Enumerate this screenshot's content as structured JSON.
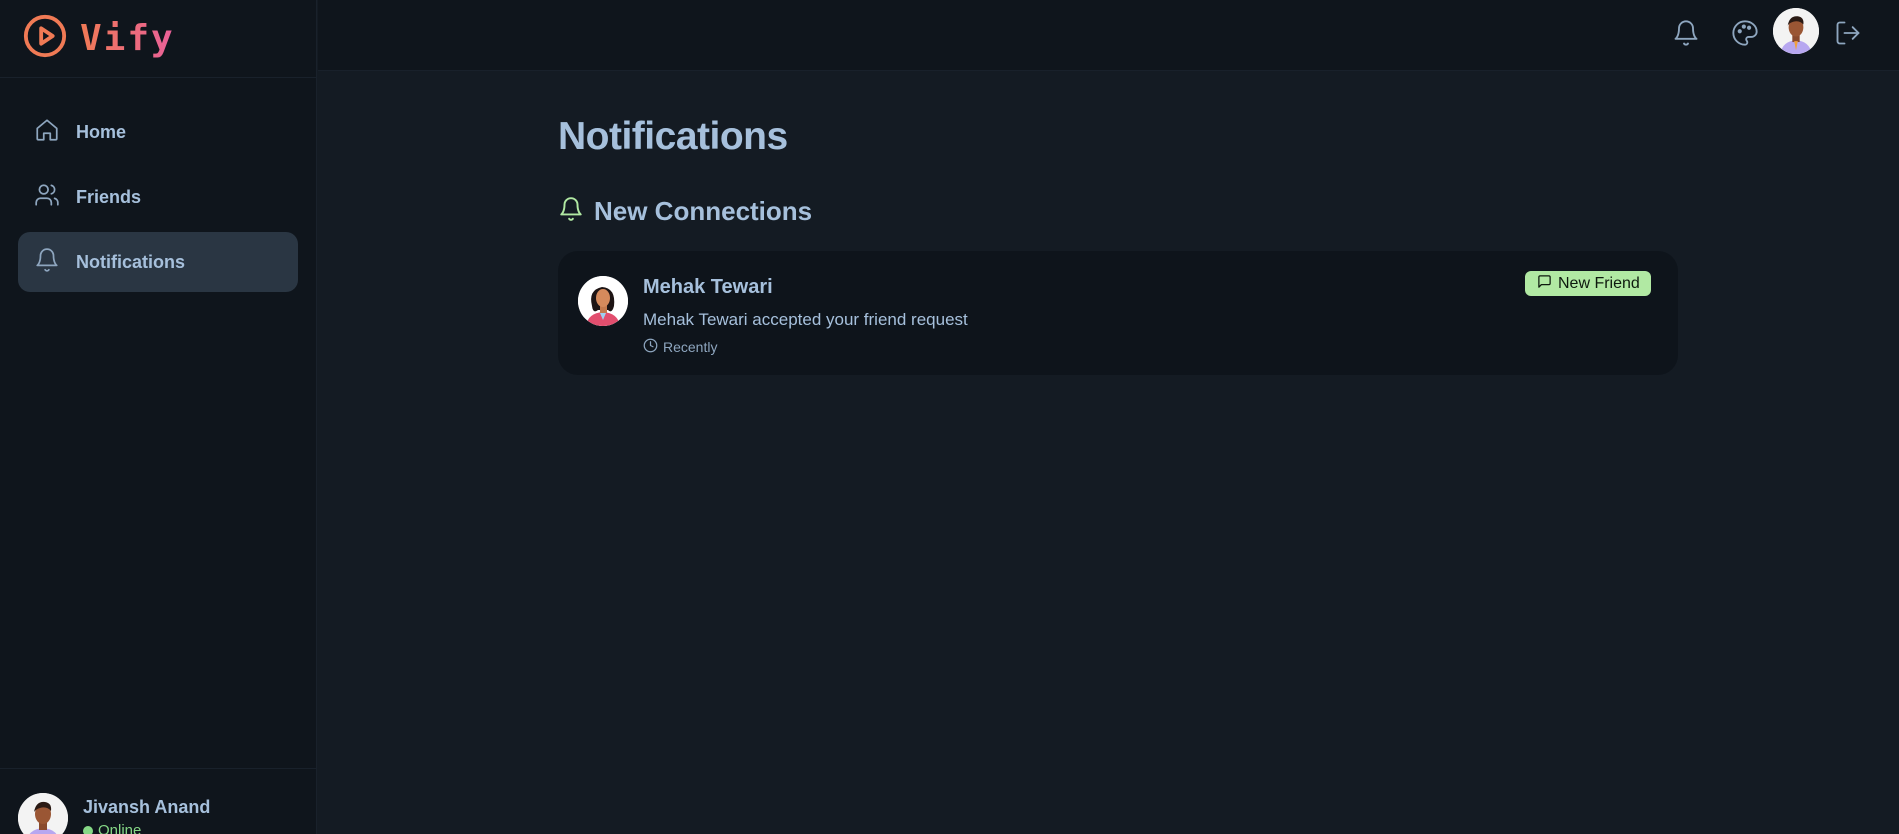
{
  "app": {
    "name": "Vify",
    "brand_gradient": [
      "#f07a55",
      "#e9609a"
    ],
    "accent_green": "#b1e9a3",
    "logo_icon": "play-circle-icon"
  },
  "sidebar": {
    "items": [
      {
        "label": "Home",
        "icon": "home-icon",
        "active": false
      },
      {
        "label": "Friends",
        "icon": "users-icon",
        "active": false
      },
      {
        "label": "Notifications",
        "icon": "bell-icon",
        "active": true
      }
    ],
    "user": {
      "name": "Jivansh Anand",
      "status": "Online"
    }
  },
  "header": {
    "icons": [
      "bell-icon",
      "palette-icon",
      "avatar",
      "logout-icon"
    ]
  },
  "main": {
    "title": "Notifications",
    "section_title": "New Connections",
    "notifications": [
      {
        "name": "Mehak Tewari",
        "message": "Mehak Tewari accepted your friend request",
        "time": "Recently",
        "badge": "New Friend"
      }
    ]
  }
}
